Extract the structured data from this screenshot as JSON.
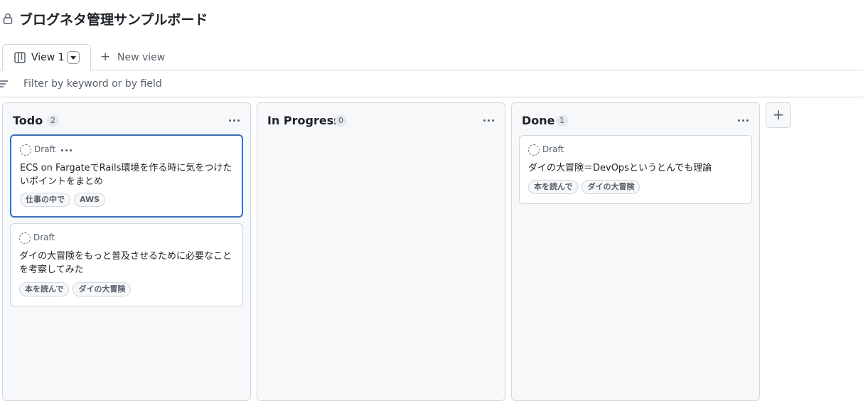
{
  "header": {
    "title": "ブログネタ管理サンプルボード"
  },
  "tabs": {
    "active_label": "View 1",
    "new_view_label": "New view"
  },
  "filter": {
    "placeholder": "Filter by keyword or by field"
  },
  "columns": [
    {
      "name": "Todo",
      "count": "2",
      "cards": [
        {
          "status": "Draft",
          "title": "ECS on FargateでRails環境を作る時に気をつけたいポイントをまとめ",
          "labels": [
            "仕事の中で",
            "AWS"
          ]
        },
        {
          "status": "Draft",
          "title": "ダイの大冒険をもっと普及させるために必要なことを考察してみた",
          "labels": [
            "本を読んで",
            "ダイの大冒険"
          ]
        }
      ]
    },
    {
      "name": "In Progress",
      "count": "0",
      "cards": []
    },
    {
      "name": "Done",
      "count": "1",
      "cards": [
        {
          "status": "Draft",
          "title": "ダイの大冒険＝DevOpsというとんでも理論",
          "labels": [
            "本を読んで",
            "ダイの大冒険"
          ]
        }
      ]
    }
  ],
  "add_column_label": "+",
  "icons": {
    "lock": "lock-icon",
    "board": "project-board-icon",
    "filter": "filter-icon",
    "draft": "draft-issue-icon"
  },
  "colors": {
    "selected_border": "#3f6fb5",
    "column_bg": "#f6f8fa",
    "border": "#d0d7de"
  }
}
